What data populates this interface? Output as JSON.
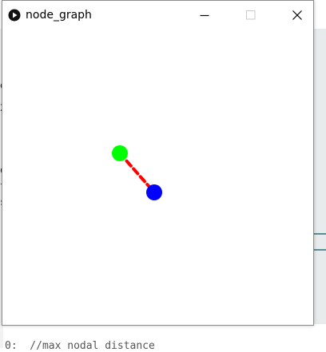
{
  "window": {
    "title": "node_graph"
  },
  "background_editor": {
    "visible_code": "0:  //max nodal distance"
  },
  "graph": {
    "nodes": [
      {
        "id": "green",
        "color": "#00ff00"
      },
      {
        "id": "blue",
        "color": "#0000ff"
      }
    ],
    "edges": [
      {
        "from": "green",
        "to": "blue",
        "color": "#ff0000",
        "style": "dashed"
      }
    ]
  },
  "colors": {
    "titlebar_bg": "#ffffff",
    "window_border": "#8c8c8c",
    "canvas_bg": "#ffffff"
  }
}
